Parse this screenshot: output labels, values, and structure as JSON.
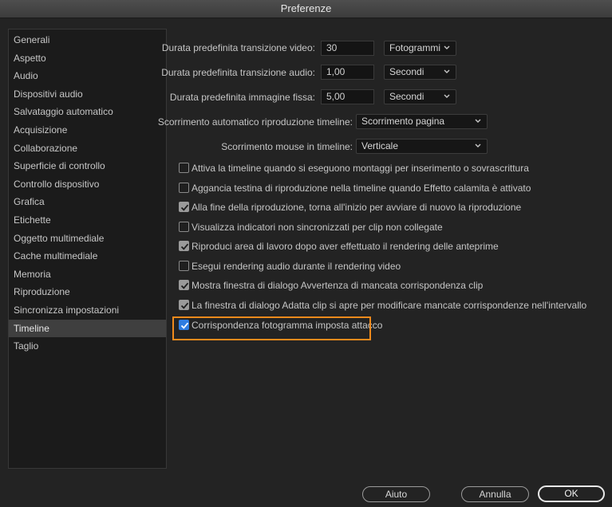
{
  "window": {
    "title": "Preferenze"
  },
  "sidebar": {
    "items": [
      {
        "label": "Generali"
      },
      {
        "label": "Aspetto"
      },
      {
        "label": "Audio"
      },
      {
        "label": "Dispositivi audio"
      },
      {
        "label": "Salvataggio automatico"
      },
      {
        "label": "Acquisizione"
      },
      {
        "label": "Collaborazione"
      },
      {
        "label": "Superficie di controllo"
      },
      {
        "label": "Controllo dispositivo"
      },
      {
        "label": "Grafica"
      },
      {
        "label": "Etichette"
      },
      {
        "label": "Oggetto multimediale"
      },
      {
        "label": "Cache multimediale"
      },
      {
        "label": "Memoria"
      },
      {
        "label": "Riproduzione"
      },
      {
        "label": "Sincronizza impostazioni"
      },
      {
        "label": "Timeline",
        "selected": true
      },
      {
        "label": "Taglio"
      }
    ]
  },
  "settings": {
    "video_transition": {
      "label": "Durata predefinita transizione video:",
      "value": "30",
      "unit": "Fotogrammi"
    },
    "audio_transition": {
      "label": "Durata predefinita transizione audio:",
      "value": "1,00",
      "unit": "Secondi"
    },
    "still_image": {
      "label": "Durata predefinita immagine fissa:",
      "value": "5,00",
      "unit": "Secondi"
    },
    "auto_scroll": {
      "label": "Scorrimento automatico riproduzione timeline:",
      "value": "Scorrimento pagina"
    },
    "mouse_scroll": {
      "label": "Scorrimento mouse in timeline:",
      "value": "Verticale"
    }
  },
  "checkboxes": [
    {
      "label": "Attiva la timeline quando si eseguono montaggi per inserimento o sovrascrittura",
      "checked": false
    },
    {
      "label": "Aggancia testina di riproduzione nella timeline quando Effetto calamita è attivato",
      "checked": false
    },
    {
      "label": "Alla fine della riproduzione, torna all'inizio per avviare di nuovo la riproduzione",
      "checked": true
    },
    {
      "label": "Visualizza indicatori non sincronizzati per clip non collegate",
      "checked": false
    },
    {
      "label": "Riproduci area di lavoro dopo aver effettuato il rendering delle anteprime",
      "checked": true
    },
    {
      "label": "Esegui rendering audio durante il rendering video",
      "checked": false
    },
    {
      "label": "Mostra finestra di dialogo Avvertenza di mancata corrispondenza clip",
      "checked": true
    },
    {
      "label": "La finestra di dialogo Adatta clip si apre per modificare mancate corrispondenze nell'intervallo",
      "checked": true
    },
    {
      "label": "Corrispondenza fotogramma imposta attacco",
      "checked": true
    }
  ],
  "buttons": {
    "help": "Aiuto",
    "cancel": "Annulla",
    "ok": "OK"
  },
  "colors": {
    "highlight": "#f08a1c",
    "accent_check": "#2f7de1"
  }
}
